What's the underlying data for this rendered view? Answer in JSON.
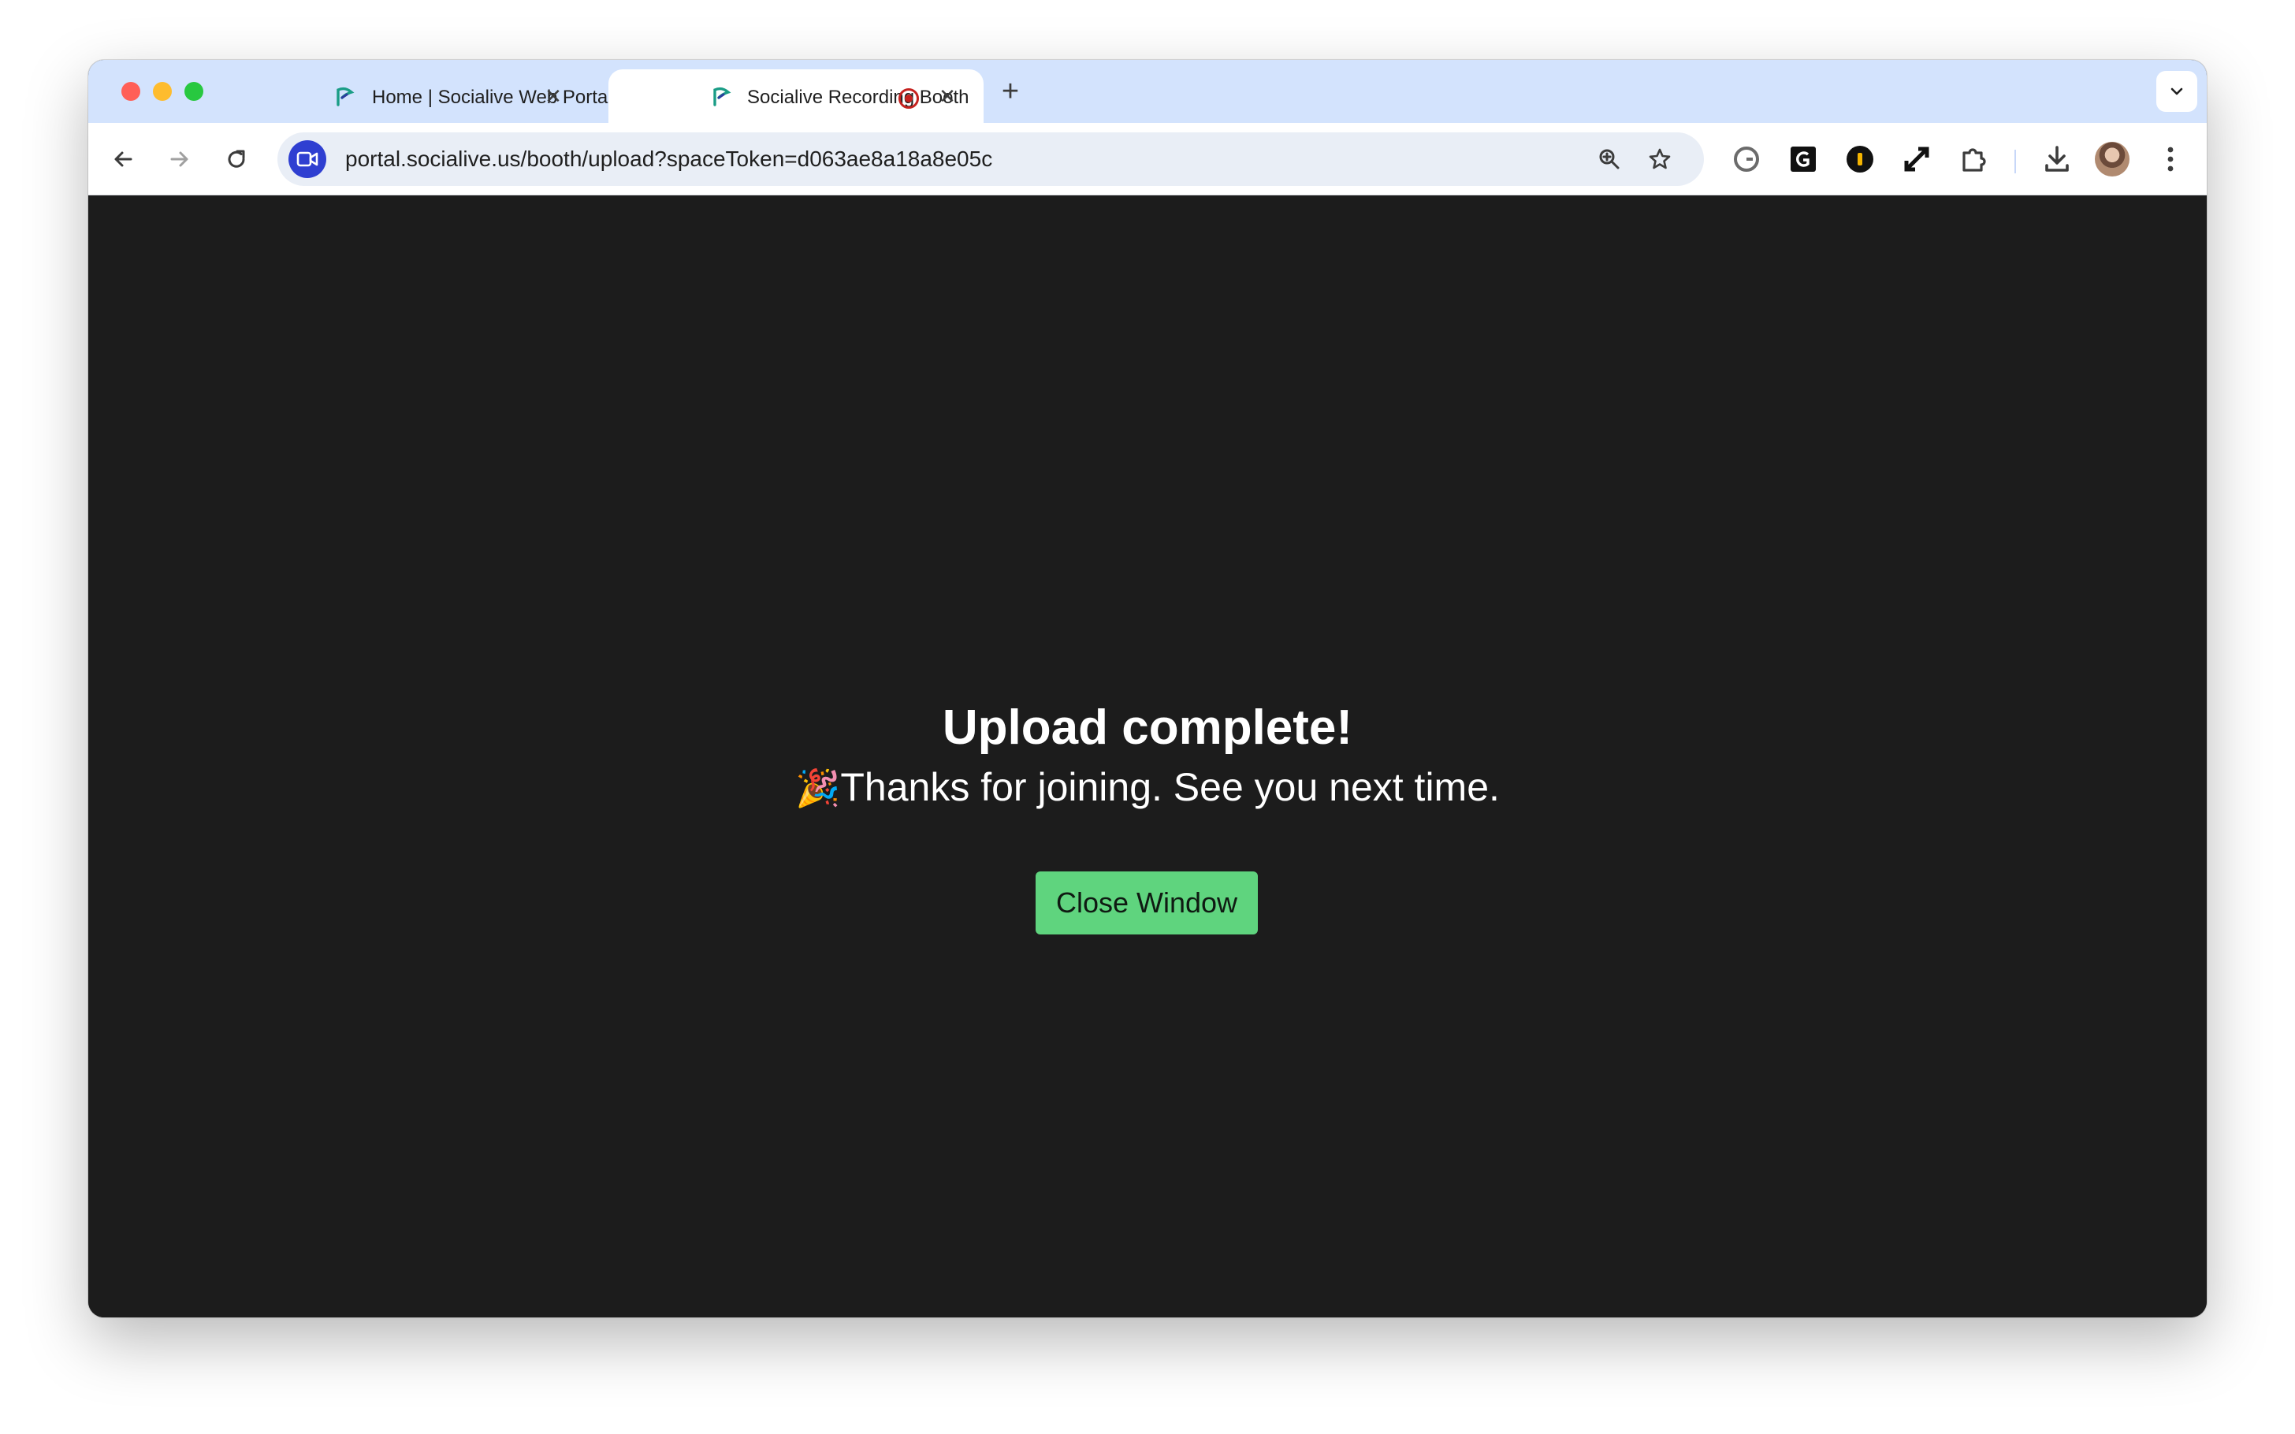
{
  "browser": {
    "tabs": [
      {
        "title": "Home | Socialive Web Portal",
        "active": false,
        "favicon": "socialive-logo-icon"
      },
      {
        "title": "Socialive Recording Booth",
        "active": true,
        "favicon": "socialive-logo-icon",
        "indicator": "recording-indicator-icon"
      }
    ],
    "close_glyph": "✕",
    "new_tab_glyph": "+",
    "url": "portal.socialive.us/booth/upload?spaceToken=d063ae8a18a8e05c",
    "site_icon": "video-camera-icon",
    "omnibox_icons": [
      "zoom-icon",
      "bookmark-star-icon"
    ],
    "extensions": [
      "grammarly-icon",
      "grammarly-g-icon",
      "password-manager-icon",
      "expand-icon",
      "extensions-puzzle-icon"
    ],
    "toolbar_icons": [
      "back-arrow-icon",
      "forward-arrow-icon",
      "reload-icon",
      "download-icon",
      "profile-avatar",
      "more-menu-icon"
    ]
  },
  "page": {
    "headline": "Upload complete!",
    "emoji": "🎉",
    "message": "Thanks for joining. See you next time.",
    "button_label": "Close Window"
  },
  "colors": {
    "tabstrip_bg": "#d3e3fd",
    "page_bg": "#1c1c1c",
    "button_bg": "#5fd47e",
    "site_icon_bg": "#2f3fd1",
    "record_red": "#c5221f"
  }
}
